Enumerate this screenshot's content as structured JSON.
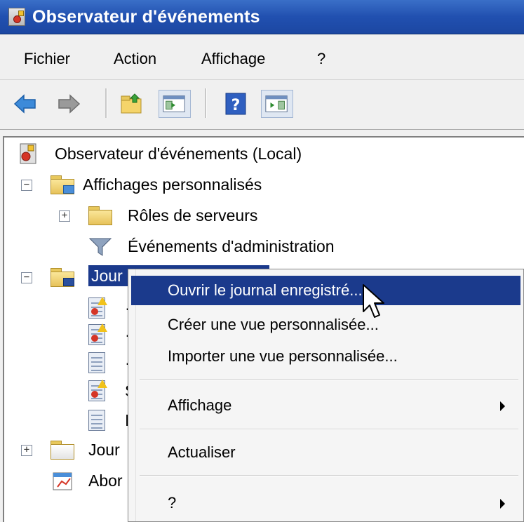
{
  "window": {
    "title": "Observateur d'événements"
  },
  "menubar": {
    "items": [
      "Fichier",
      "Action",
      "Affichage",
      "?"
    ]
  },
  "toolbar": {
    "buttons": [
      "back-arrow-icon",
      "forward-arrow-icon",
      "up-folder-icon",
      "show-hide-console-tree-icon",
      "help-icon",
      "show-hide-action-pane-icon"
    ]
  },
  "tree": {
    "root": "Observateur d'événements (Local)",
    "custom_views": "Affichages personnalisés",
    "server_roles": "Rôles de serveurs",
    "admin_events": "Événements d'administration",
    "windows_logs_partial": "Jour",
    "windows_logs_partial2": "Jour",
    "subscriptions_partial": "Abor",
    "child_glyphs": [
      "·",
      "·",
      "·",
      "S",
      "I"
    ]
  },
  "context_menu": {
    "items": [
      {
        "label": "Ouvrir le journal enregistré...",
        "highlighted": true
      },
      {
        "label": "Créer une vue personnalisée..."
      },
      {
        "label": "Importer une vue personnalisée..."
      },
      {
        "label": "Affichage",
        "submenu": true
      },
      {
        "label": "Actualiser"
      },
      {
        "label": "?",
        "submenu": true
      }
    ]
  },
  "colors": {
    "title_bar": "#2150b0",
    "selection": "#1b3a8c",
    "menu_bg": "#f5f5f5"
  }
}
